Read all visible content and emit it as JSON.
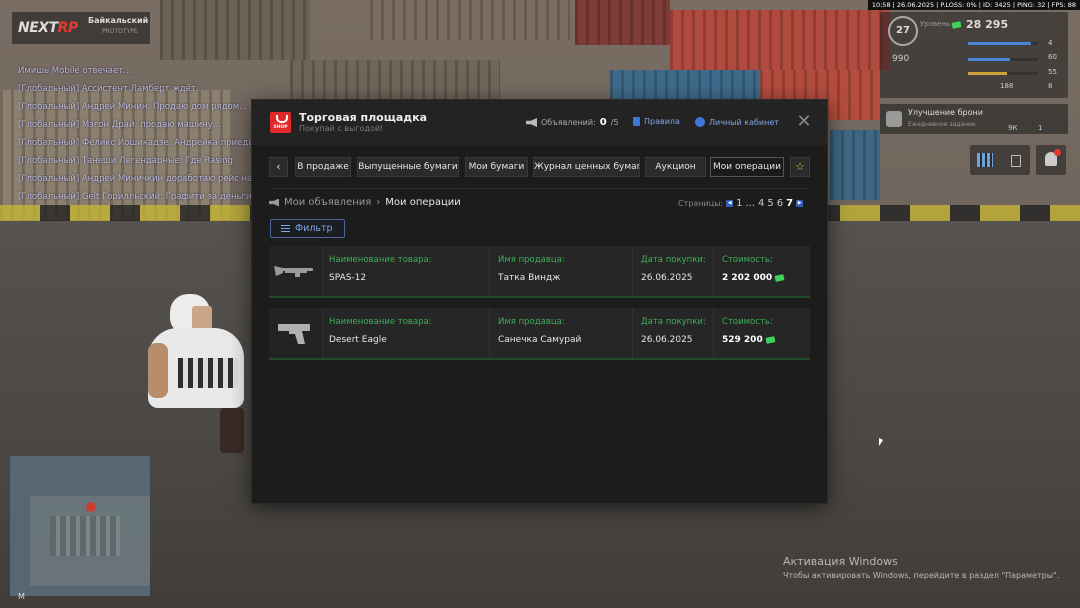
{
  "hud": {
    "status_bar": "10:58 | 26.06.2025 | P.LOSS: 0% | ID: 3425 | PING: 32 | FPS: 88",
    "brand": "NEXTRP",
    "brand_accent": "RP",
    "brand_main": "NEXT",
    "server_name": "Байкальский",
    "server_sub": "PROTOTYPE",
    "level": "27",
    "level_label": "Уровень",
    "money": "28 295",
    "cash": "990",
    "health": "60",
    "armor_value": "55",
    "stat_small_1": "4",
    "stat_small_2": "8",
    "ammo": "188",
    "armor_title": "Улучшение брони",
    "armor_sub": "Ежедневное задание",
    "armor_count_1": "9К",
    "armor_count_2": "1",
    "minimap_label": "М",
    "chat": [
      "Имишь Mobile отвечает...",
      "[Глобальный] Ассистент Ламберт ждёт...",
      "[Глобальный] Андрей Минин: Продаю дом рядом...",
      "[Глобальный] Мэгон Драй: продаю машину...",
      "[Глобальный] Феликс Иошикадзе: Андрейка приедь на подъезду",
      "[Глобальный] Танеши Легендарные: Где Rasing",
      "[Глобальный] Андрей Миничкин доработаю рейс на...",
      "[Глобальный] Gelt Горилльский: Графити за деньги"
    ],
    "windows_title": "Активация Windows",
    "windows_sub": "Чтобы активировать Windows, перейдите в раздел \"Параметры\"."
  },
  "modal": {
    "title": "Торговая площадка",
    "subtitle": "Покупай с выгодой!",
    "shop_badge": "SHOP",
    "ads_label": "Объявлений:",
    "ads_count": "0",
    "ads_total": "/5",
    "rules_label": "Правила",
    "cabinet_label": "Личный кабинет",
    "close_icon": "close-icon",
    "tabs": [
      "В продаже",
      "Выпущенные бумаги",
      "Мои бумаги",
      "Журнал ценных бумаг",
      "Аукцион",
      "Мои операции"
    ],
    "active_tab": "Мои операции",
    "breadcrumb_root": "Мои объявления",
    "breadcrumb_current": "Мои операции",
    "pages_label": "Страницы:",
    "pages": [
      "1",
      "...",
      "4",
      "5",
      "6",
      "7"
    ],
    "current_page": "7",
    "filter_label": "Фильтр",
    "columns": {
      "item": "Наименование товара:",
      "seller": "Имя продавца:",
      "date": "Дата покупки:",
      "cost": "Стоимость:"
    },
    "operations": [
      {
        "item": "SPAS-12",
        "seller": "Татка Виндж",
        "date": "26.06.2025",
        "cost": "2 202 000",
        "icon": "shotgun-icon"
      },
      {
        "item": "Desert Eagle",
        "seller": "Санечка Самурай",
        "date": "26.06.2025",
        "cost": "529 200",
        "icon": "pistol-icon"
      }
    ]
  },
  "colors": {
    "accent_green": "#3fae5a",
    "accent_blue": "#7fa6e6",
    "shop_red": "#e02a2a"
  }
}
